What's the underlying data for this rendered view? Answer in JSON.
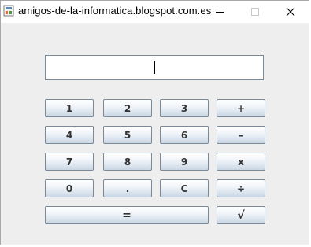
{
  "window": {
    "title": "amigos-de-la-informatica.blogspot.com.es"
  },
  "display": {
    "value": ""
  },
  "keypad": {
    "rows": [
      [
        "1",
        "2",
        "3",
        "+"
      ],
      [
        "4",
        "5",
        "6",
        "–"
      ],
      [
        "7",
        "8",
        "9",
        "x"
      ],
      [
        "0",
        ".",
        "C",
        "÷"
      ]
    ],
    "equals": "=",
    "sqrt": "√"
  },
  "icons": {
    "app": "java-app-icon",
    "minimize": "minimize-icon",
    "maximize": "maximize-icon",
    "close": "close-icon"
  }
}
